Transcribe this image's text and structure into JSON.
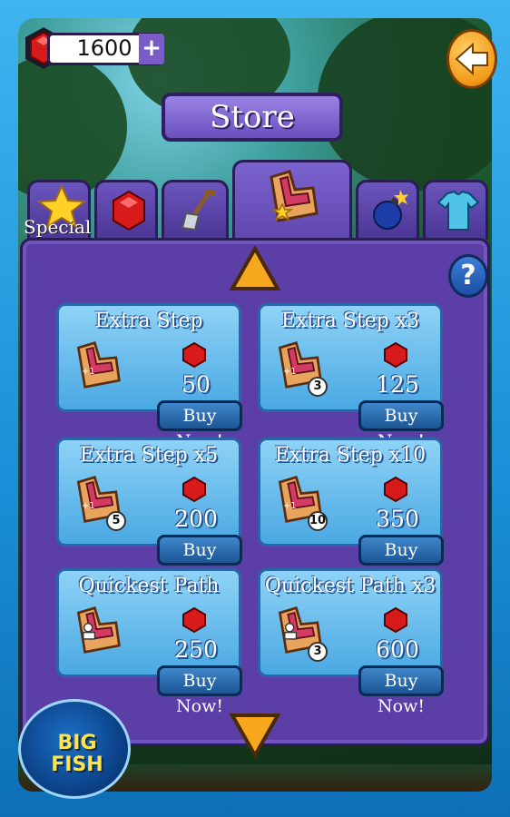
{
  "store": {
    "gems": "1600",
    "plus_label": "+",
    "title": "Store",
    "special_label": "Special",
    "help_label": "?",
    "brand": "BIG FISH"
  },
  "tabs": [
    {
      "icon": "star-icon"
    },
    {
      "icon": "red-gem-icon"
    },
    {
      "icon": "shovel-icon"
    },
    {
      "icon": "extra-step-icon",
      "active": true
    },
    {
      "icon": "bomb-icon"
    },
    {
      "icon": "shirt-icon"
    }
  ],
  "items": [
    {
      "name": "Extra Step",
      "price": "50",
      "badge": "",
      "buy": "Buy Now!"
    },
    {
      "name": "Extra Step x3",
      "price": "125",
      "badge": "3",
      "buy": "Buy Now!"
    },
    {
      "name": "Extra Step x5",
      "price": "200",
      "badge": "5",
      "buy": "Buy Now!"
    },
    {
      "name": "Extra Step x10",
      "price": "350",
      "badge": "10",
      "buy": "Buy Now!"
    },
    {
      "name": "Quickest Path",
      "price": "250",
      "badge": "",
      "buy": "Buy Now!"
    },
    {
      "name": "Quickest Path x3",
      "price": "600",
      "badge": "3",
      "buy": "Buy Now!"
    }
  ],
  "colors": {
    "panel": "#5b3fa6",
    "item": "#4aa8e2",
    "gem": "#d71a1a",
    "accent": "#f39a18"
  }
}
